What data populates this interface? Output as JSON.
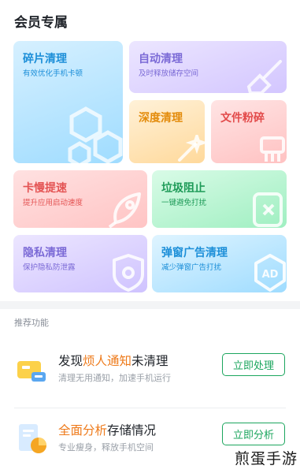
{
  "member_section": {
    "title": "会员专属",
    "cards": {
      "fragment": {
        "title": "碎片清理",
        "subtitle": "有效优化手机卡顿"
      },
      "auto": {
        "title": "自动清理",
        "subtitle": "及时释放储存空间"
      },
      "deep": {
        "title": "深度清理"
      },
      "shred": {
        "title": "文件粉碎"
      },
      "lag": {
        "title": "卡慢提速",
        "subtitle": "提升应用启动速度"
      },
      "block": {
        "title": "垃圾阻止",
        "subtitle": "一键避免打扰"
      },
      "privacy": {
        "title": "隐私清理",
        "subtitle": "保护隐私防泄露"
      },
      "popup": {
        "title": "弹窗广告清理",
        "subtitle": "减少弹窗广告打扰"
      }
    }
  },
  "recommend": {
    "title": "推荐功能",
    "items": [
      {
        "head_pre": "发现",
        "head_hl": "烦人通知",
        "head_post": "未清理",
        "desc": "清理无用通知，加速手机运行",
        "button": "立即处理"
      },
      {
        "head_pre": "",
        "head_hl": "全面分析",
        "head_post": "存储情况",
        "desc": "专业瘦身，释放手机空间",
        "button": "立即分析"
      }
    ]
  },
  "watermark": "煎蛋手游",
  "colors": {
    "accent_green": "#1ca65e",
    "highlight_orange": "#ee7a1a"
  }
}
